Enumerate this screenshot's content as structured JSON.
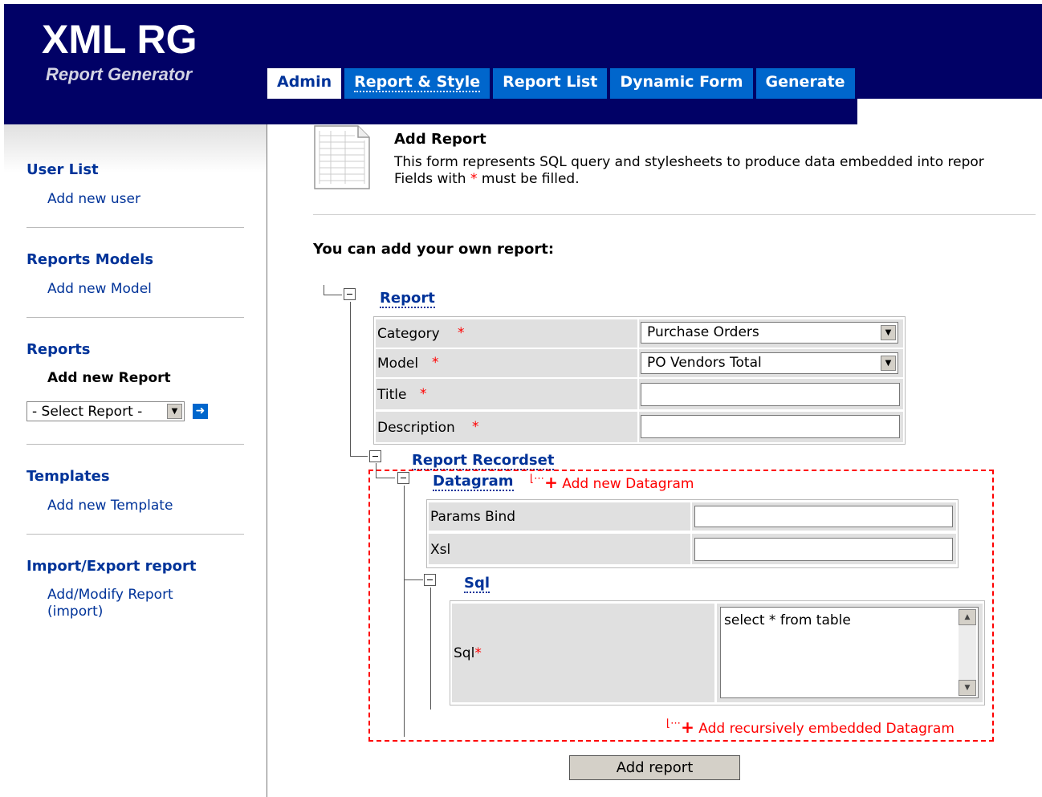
{
  "app": {
    "title": "XML RG",
    "subtitle": "Report Generator"
  },
  "tabs": [
    {
      "label": "Admin"
    },
    {
      "label": "Report & Style"
    },
    {
      "label": "Report List"
    },
    {
      "label": "Dynamic Form"
    },
    {
      "label": "Generate"
    }
  ],
  "sidebar": {
    "sections": [
      {
        "heading": "User List",
        "link": "Add new user"
      },
      {
        "heading": "Reports Models",
        "link": "Add new Model"
      },
      {
        "heading": "Reports",
        "link": "Add new Report",
        "select": "- Select Report -"
      },
      {
        "heading": "Templates",
        "link": "Add new Template"
      },
      {
        "heading": "Import/Export report",
        "link": "Add/Modify Report",
        "link2": "(import)"
      }
    ]
  },
  "page": {
    "title": "Add Report",
    "desc1": "This form represents SQL query and stylesheets to produce data embedded into repor",
    "desc2_a": "Fields with ",
    "desc2_star": "*",
    "desc2_b": " must be filled.",
    "intro": "You can add your own report:"
  },
  "report": {
    "label": "Report",
    "fields": [
      {
        "label": "Category",
        "req": "*",
        "value": "Purchase Orders"
      },
      {
        "label": "Model",
        "req": "*",
        "value": "PO Vendors Total"
      },
      {
        "label": "Title",
        "req": "*",
        "value": ""
      },
      {
        "label": "Description",
        "req": "*",
        "value": ""
      }
    ]
  },
  "recordset": {
    "label": "Report Recordset",
    "datagram_label": "Datagram",
    "add_datagram": "Add new Datagram",
    "params_bind": "Params Bind",
    "xsl": "Xsl",
    "sql_label": "Sql",
    "sql_field": "Sql",
    "sql_req": "*",
    "sql_value": "select * from table",
    "add_embedded": "Add recursively embedded Datagram"
  },
  "submit": "Add report"
}
